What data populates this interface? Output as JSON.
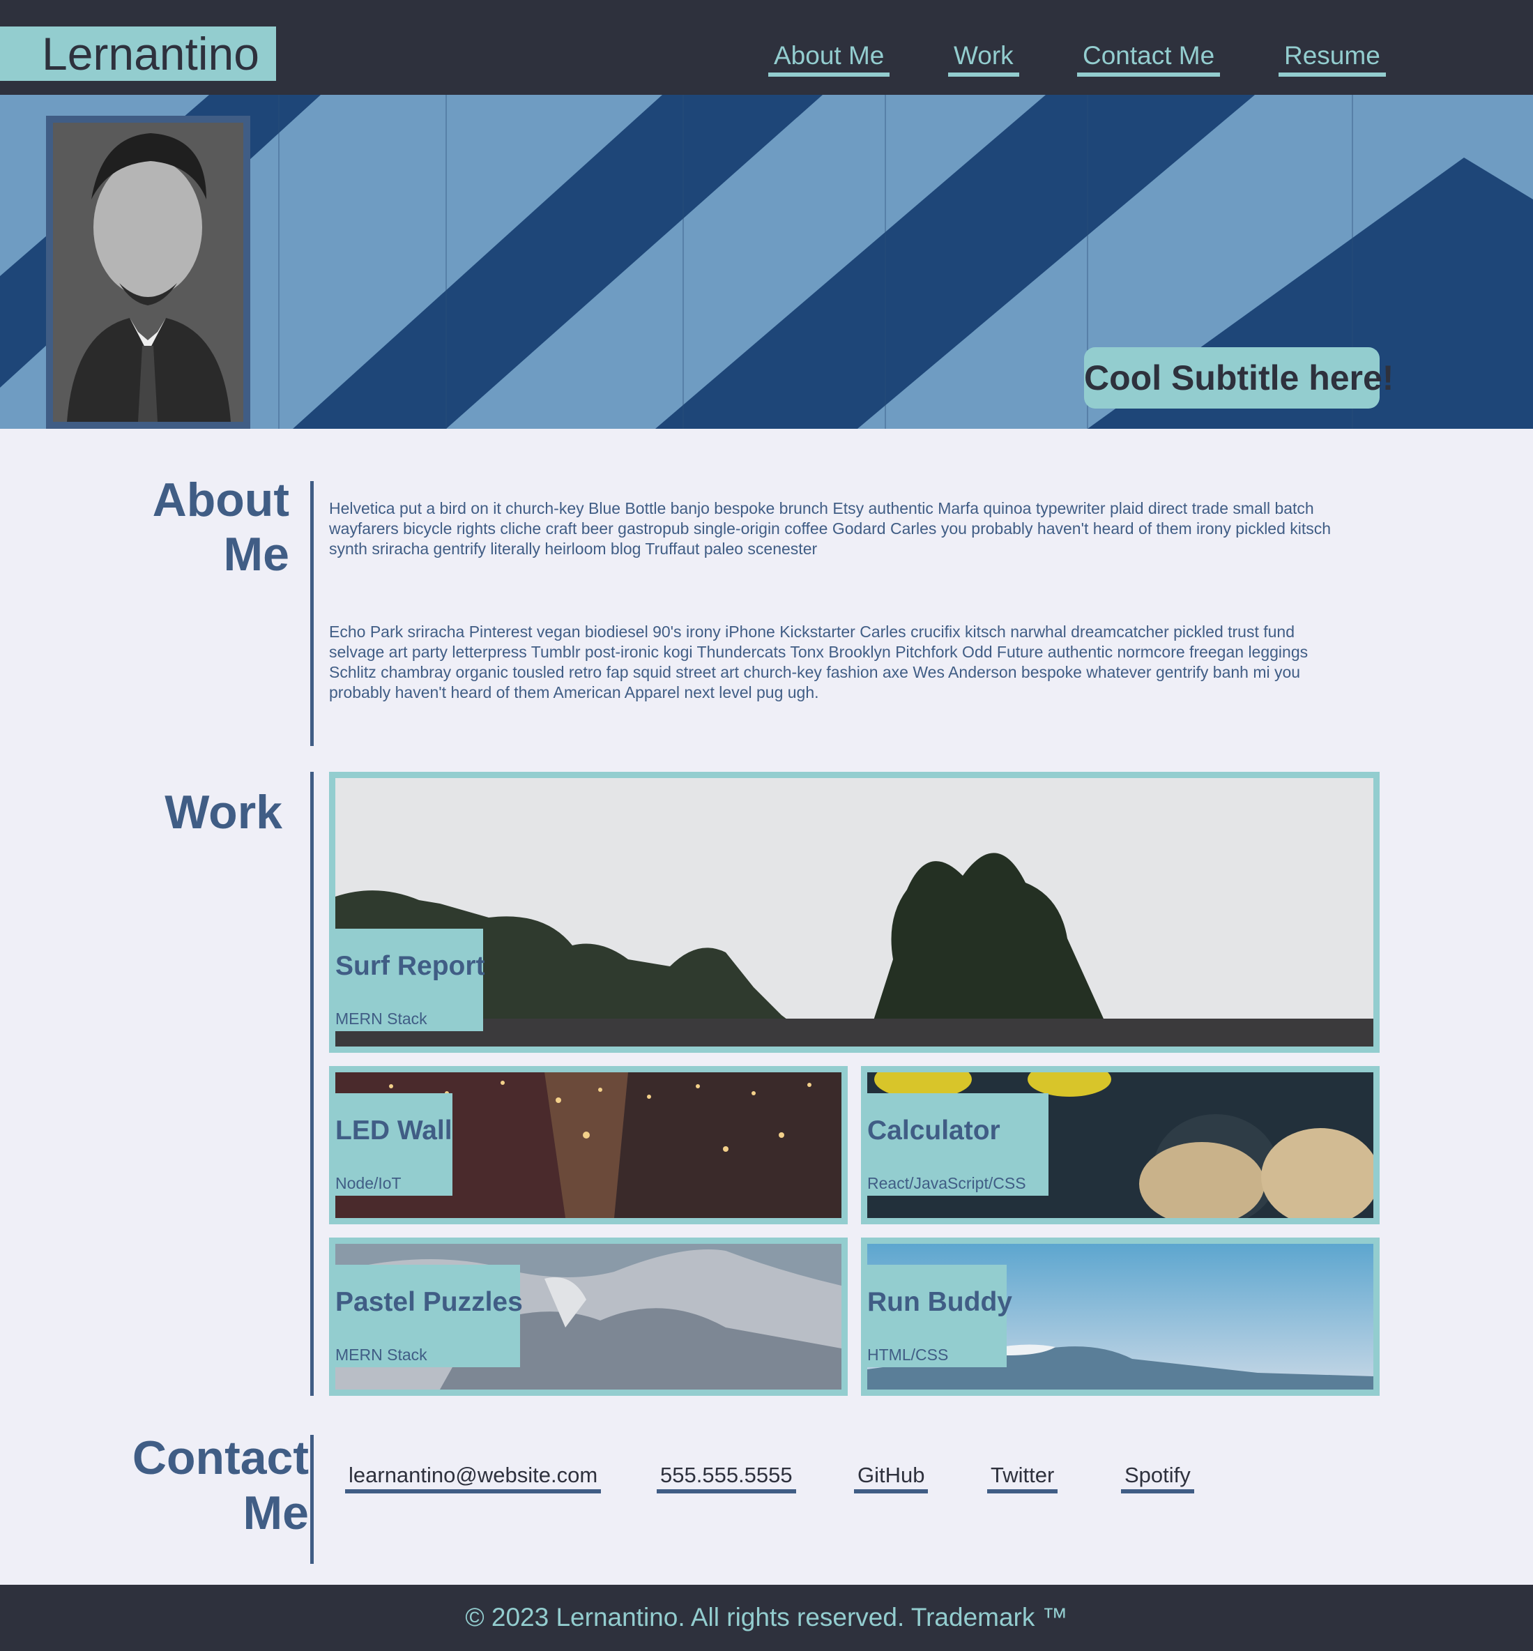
{
  "header": {
    "brand": "Lernantino",
    "nav": [
      "About Me",
      "Work",
      "Contact Me",
      "Resume"
    ]
  },
  "hero": {
    "subtitle": "Cool Subtitle here!"
  },
  "about": {
    "title_line1": "About",
    "title_line2": "Me",
    "paragraphs": [
      "Helvetica put a bird on it church-key Blue Bottle banjo bespoke brunch Etsy authentic Marfa quinoa typewriter plaid direct trade small batch wayfarers bicycle rights cliche craft beer gastropub single-origin coffee Godard Carles you probably haven't heard of them irony pickled kitsch synth sriracha gentrify literally heirloom blog Truffaut paleo scenester",
      "Echo Park sriracha Pinterest vegan biodiesel 90's irony iPhone Kickstarter Carles crucifix kitsch narwhal dreamcatcher pickled trust fund selvage art party letterpress Tumblr post-ironic kogi Thundercats Tonx Brooklyn Pitchfork Odd Future authentic normcore freegan leggings Schlitz chambray organic tousled retro fap squid street art church-key fashion axe Wes Anderson bespoke whatever gentrify banh mi you probably haven't heard of them American Apparel next level pug ugh."
    ]
  },
  "work": {
    "title": "Work",
    "projects": [
      {
        "title": "Surf Report",
        "stack": "MERN Stack"
      },
      {
        "title": "LED Wall",
        "stack": "Node/IoT"
      },
      {
        "title": "Calculator",
        "stack": "React/JavaScript/CSS"
      },
      {
        "title": "Pastel Puzzles",
        "stack": "MERN Stack"
      },
      {
        "title": "Run Buddy",
        "stack": "HTML/CSS"
      }
    ]
  },
  "contact": {
    "title_line1": "Contact",
    "title_line2": "Me",
    "links": [
      "learnantino@website.com",
      "555.555.5555",
      "GitHub",
      "Twitter",
      "Spotify"
    ]
  },
  "footer": {
    "text": "© 2023 Lernantino. All rights reserved. Trademark ™"
  },
  "colors": {
    "dark": "#2e313d",
    "teal": "#93cdcf",
    "navy": "#405d85",
    "background": "#efeff7"
  }
}
